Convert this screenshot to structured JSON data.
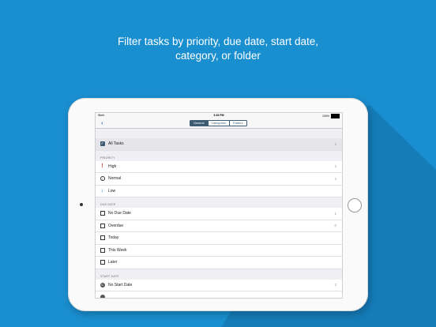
{
  "headline": {
    "line1": "Filter tasks by priority, due date, start date,",
    "line2": "category, or folder"
  },
  "statusbar": {
    "carrier": "Work",
    "time": "3:33 PM",
    "battery": "100%"
  },
  "navbar": {
    "back_icon": "chevron-left-icon",
    "segments": [
      "General",
      "Categories",
      "Folders"
    ],
    "active_segment": "General"
  },
  "list": {
    "all_tasks": {
      "label": "All Tasks",
      "count": "3",
      "icon": "checkbox-icon"
    },
    "priority": {
      "header": "PRIORITY",
      "items": [
        {
          "label": "High",
          "count": "2",
          "icon": "exclamation-icon",
          "color": "#d0453a"
        },
        {
          "label": "Normal",
          "count": "3",
          "icon": "info-circle-icon",
          "color": "#333333"
        },
        {
          "label": "Low",
          "count": "",
          "icon": "down-arrow-icon",
          "color": "#1f7fc8"
        }
      ]
    },
    "due_date": {
      "header": "DUE DATE",
      "items": [
        {
          "label": "No Due Date",
          "count": "1",
          "icon": "calendar-icon"
        },
        {
          "label": "Overdue",
          "count": "0",
          "icon": "calendar-icon"
        },
        {
          "label": "Today",
          "count": "",
          "icon": "calendar-icon"
        },
        {
          "label": "This Week",
          "count": "",
          "icon": "calendar-icon"
        },
        {
          "label": "Later",
          "count": "",
          "icon": "calendar-icon"
        }
      ]
    },
    "start_date": {
      "header": "START DATE",
      "items": [
        {
          "label": "No Start Date",
          "count": "2",
          "icon": "start-circle-icon"
        }
      ]
    }
  },
  "colors": {
    "background": "#1a8fd0",
    "accent": "#3d5a73"
  }
}
